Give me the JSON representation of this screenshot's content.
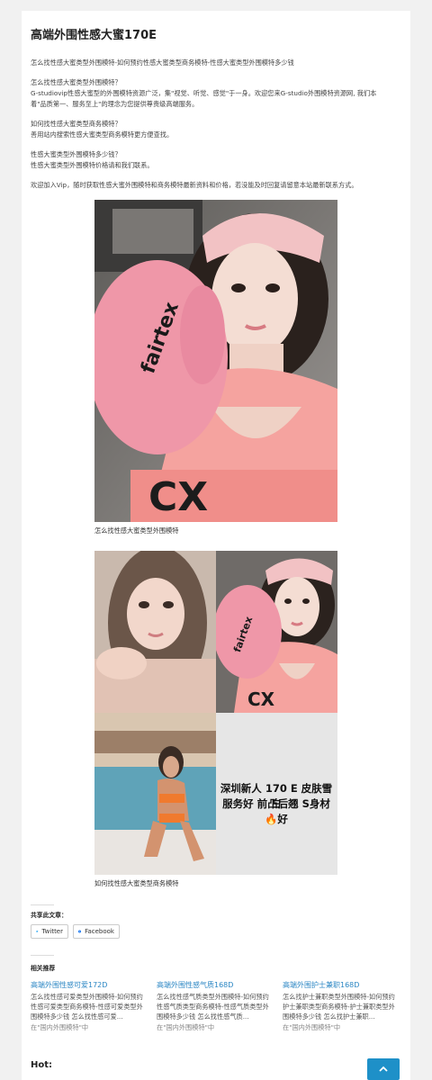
{
  "article": {
    "title": "高端外围性感大蜜170E",
    "paragraphs": [
      [
        "怎么找性感大蜜类型外围模特-如何预约性感大蜜类型商务模特-性感大蜜类型外围模特多少钱"
      ],
      [
        "怎么找性感大蜜类型外围模特？",
        "G-studiovip性感大蜜型的外围模特资源广泛，集\"视觉、听觉、感觉\"于一身。欢迎您来G-studio外围模特资源网, 我们本",
        "着\"品质第一、服务至上\"的理念为您提供尊贵级高端服务。"
      ],
      [
        "如何找性感大蜜类型商务模特？",
        "善用站内搜索性感大蜜类型商务模特更方便查找。"
      ],
      [
        "性感大蜜类型外围模特多少钱？",
        "性感大蜜类型外围模特价格请和我们联系。"
      ],
      [
        "欢迎加入Vip，随时获取性感大蜜外围模特和商务模特最新资料和价格，若没能及时回复请留意本站最新联系方式。"
      ]
    ],
    "caption_1": "怎么找性感大蜜类型外围模特",
    "caption_2": "如何找性感大蜜类型商务模特",
    "gallery_overlay": [
      "深圳新人 170 E 皮肤雪白",
      "服务好 前凸后翘 S身材🔥好"
    ]
  },
  "share": {
    "heading": "共享此文章：",
    "twitter_label": "Twitter",
    "facebook_label": "Facebook"
  },
  "related": {
    "heading": "相关推荐",
    "items": [
      {
        "title": "高端外围性感可爱172D",
        "desc": "怎么找性感可爱类型外围模特-如何预约性感可爱类型商务模特-性感可爱类型外围模特多少钱 怎么找性感可爱...",
        "category": "在\"国内外围模特\"中"
      },
      {
        "title": "高端外围性感气质168D",
        "desc": "怎么找性感气质类型外围模特-如何预约性感气质类型商务模特-性感气质类型外围模特多少钱 怎么找性感气质...",
        "category": "在\"国内外围模特\"中"
      },
      {
        "title": "高端外围护士兼职168D",
        "desc": "怎么找护士兼职类型外围模特-如何预约护士兼职类型商务模特-护士兼职类型外围模特多少钱 怎么找护士兼职...",
        "category": "在\"国内外围模特\"中"
      }
    ]
  },
  "hot": {
    "heading": "Hot:"
  },
  "colors": {
    "link": "#2c87c4",
    "accent": "#1e90c8",
    "page_bg": "#f1f1f1"
  },
  "icons": {
    "back_to_top": "chevron-up-icon",
    "twitter": "twitter-icon",
    "facebook": "facebook-icon"
  }
}
